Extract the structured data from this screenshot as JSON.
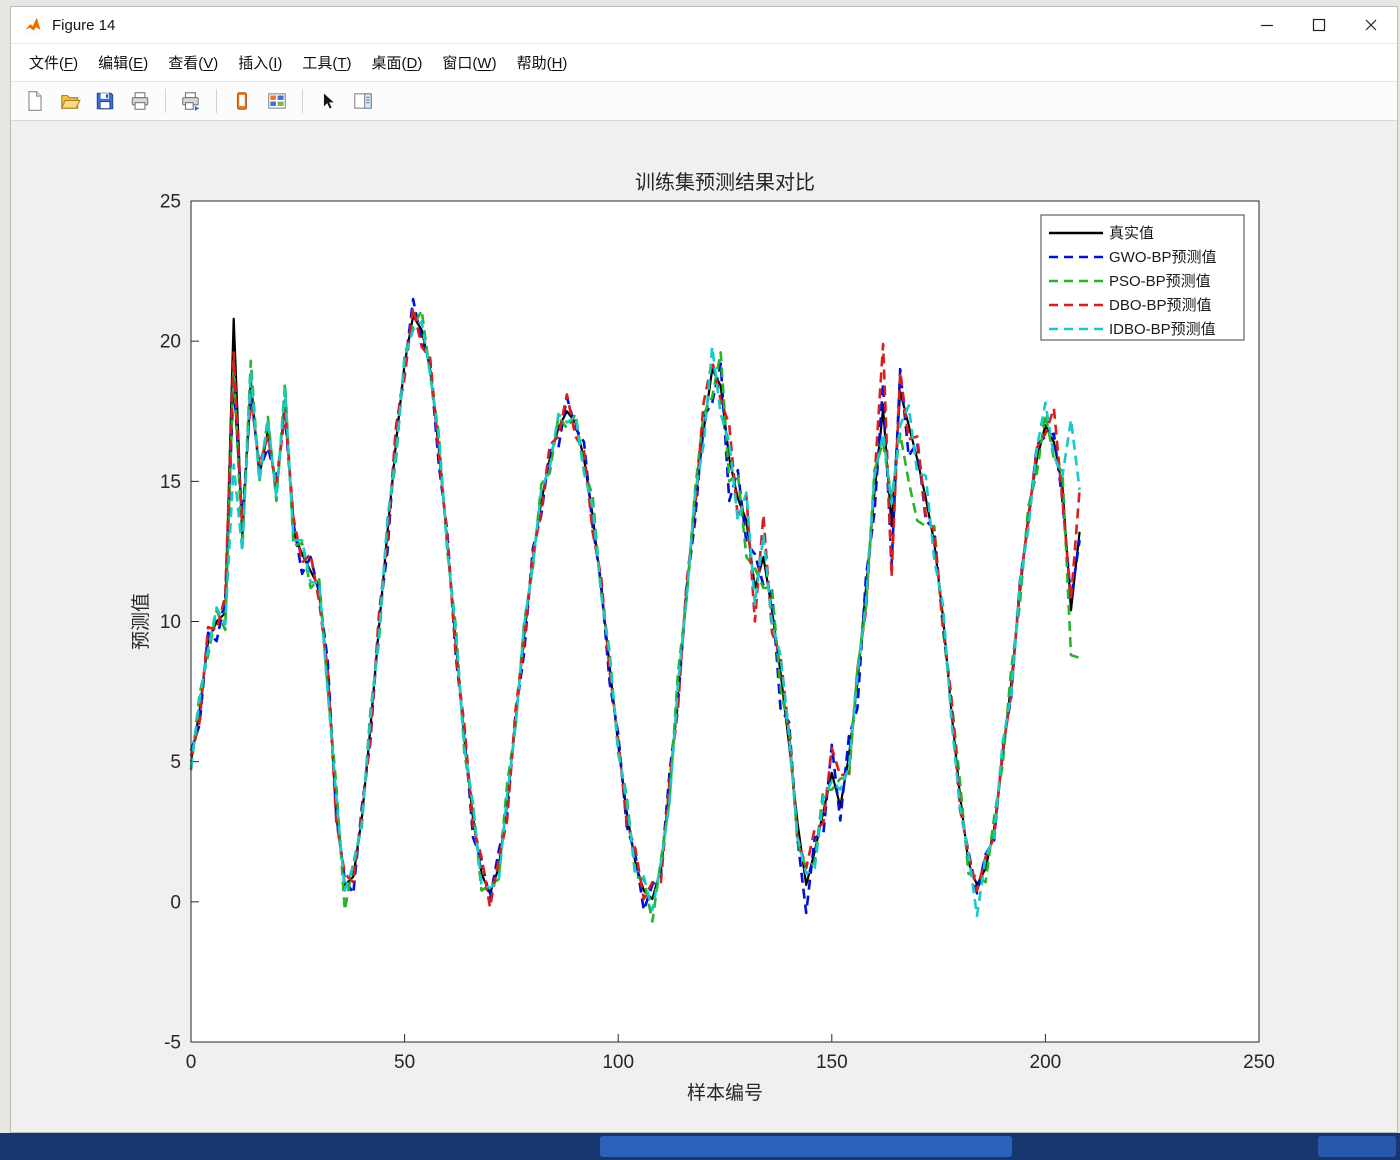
{
  "window": {
    "title": "Figure 14"
  },
  "menubar": {
    "items": [
      {
        "name": "file",
        "text": "文件",
        "key": "F"
      },
      {
        "name": "edit",
        "text": "编辑",
        "key": "E"
      },
      {
        "name": "view",
        "text": "查看",
        "key": "V"
      },
      {
        "name": "insert",
        "text": "插入",
        "key": "I"
      },
      {
        "name": "tools",
        "text": "工具",
        "key": "T"
      },
      {
        "name": "desktop",
        "text": "桌面",
        "key": "D"
      },
      {
        "name": "window",
        "text": "窗口",
        "key": "W"
      },
      {
        "name": "help",
        "text": "帮助",
        "key": "H"
      }
    ]
  },
  "toolbar": {
    "items": [
      {
        "icon": "new-figure-icon"
      },
      {
        "icon": "open-file-icon"
      },
      {
        "icon": "save-figure-icon"
      },
      {
        "icon": "print-figure-icon"
      },
      {
        "sep": true
      },
      {
        "icon": "print-preview-icon"
      },
      {
        "sep": true
      },
      {
        "icon": "mobile-preview-icon"
      },
      {
        "icon": "layout-grid-icon"
      },
      {
        "sep": true
      },
      {
        "icon": "edit-plot-cursor-icon"
      },
      {
        "icon": "side-panel-icon"
      }
    ]
  },
  "chart_data": {
    "type": "line",
    "title": "训练集预测结果对比",
    "xlabel": "样本编号",
    "ylabel": "预测值",
    "xlim": [
      0,
      250
    ],
    "ylim": [
      -5,
      25
    ],
    "x_ticks": [
      0,
      50,
      100,
      150,
      200,
      250
    ],
    "y_ticks": [
      -5,
      0,
      5,
      10,
      15,
      20,
      25
    ],
    "grid": false,
    "legend_position": "northeast",
    "x_start": 0,
    "x_step": 2,
    "base_values": [
      5.0,
      6.8,
      9.3,
      10.0,
      10.3,
      20.8,
      13.0,
      18.6,
      15.2,
      16.8,
      14.6,
      17.9,
      13.2,
      12.4,
      11.8,
      11.2,
      8.0,
      3.5,
      0.6,
      0.9,
      3.0,
      6.2,
      9.8,
      13.2,
      16.4,
      19.2,
      20.9,
      20.4,
      19.0,
      16.2,
      12.8,
      9.2,
      5.8,
      3.0,
      1.0,
      0.3,
      1.2,
      3.5,
      6.5,
      9.5,
      12.2,
      14.3,
      15.8,
      16.9,
      17.5,
      17.1,
      15.8,
      13.8,
      11.2,
      8.4,
      5.6,
      3.2,
      1.4,
      0.4,
      0.1,
      1.2,
      4.0,
      7.5,
      11.0,
      14.2,
      16.8,
      19.0,
      18.4,
      15.8,
      14.4,
      13.6,
      11.2,
      12.3,
      10.4,
      8.2,
      5.6,
      2.8,
      0.6,
      1.8,
      3.2,
      4.6,
      3.4,
      5.2,
      7.8,
      11.2,
      14.6,
      17.6,
      13.4,
      18.2,
      17.0,
      15.8,
      14.4,
      12.8,
      10.2,
      6.8,
      3.8,
      1.4,
      0.6,
      1.2,
      2.6,
      5.2,
      7.8,
      11.0,
      13.8,
      15.8,
      17.0,
      16.4,
      14.8,
      10.4,
      13.2
    ],
    "series": [
      {
        "name": "true",
        "label": "真实值",
        "color": "#000000",
        "style": "solid",
        "offsets": null
      },
      {
        "name": "gwo-bp",
        "label": "GWO-BP预测值",
        "color": "#0010d8",
        "style": "dashed",
        "offsets": [
          0.4,
          -0.5,
          0.3,
          -0.7,
          0.5,
          -2.2,
          0.6,
          -0.4,
          0.2,
          -0.6,
          0.4,
          -0.5,
          0.3,
          -0.7,
          0.5,
          -0.2,
          0.6,
          -0.4,
          0.2,
          -0.6,
          0.4,
          -0.5,
          0.3,
          -0.7,
          0.5,
          -0.2,
          0.6,
          -0.4,
          0.2,
          -0.6,
          0.4,
          -0.5,
          0.3,
          -0.7,
          0.5,
          -0.2,
          0.6,
          -0.4,
          0.2,
          -0.6,
          0.4,
          -0.5,
          0.3,
          -0.7,
          0.5,
          -0.2,
          0.6,
          -0.4,
          0.2,
          -0.6,
          0.4,
          -0.5,
          0.3,
          -0.7,
          0.5,
          -0.2,
          0.6,
          -0.4,
          0.2,
          -0.6,
          0.5,
          -1.2,
          0.8,
          -1.5,
          1.0,
          -0.8,
          1.2,
          -1.0,
          0.6,
          -1.3,
          0.8,
          -0.6,
          -1.0,
          0.5,
          -0.8,
          1.0,
          -0.5,
          0.7,
          -0.9,
          0.4,
          -0.7,
          0.9,
          -1.4,
          0.8,
          -1.1,
          0.6,
          -0.8,
          0.5,
          -0.4,
          0.3,
          -0.5,
          0.4,
          -0.3,
          0.5,
          -0.4,
          0.3,
          -0.5,
          0.4,
          -0.3,
          0.5,
          -0.4,
          0.3,
          -0.5,
          0.4,
          -0.3
        ]
      },
      {
        "name": "pso-bp",
        "label": "PSO-BP预测值",
        "color": "#28b428",
        "style": "dashed",
        "offsets": [
          -0.3,
          0.6,
          -0.5,
          0.4,
          -0.6,
          -1.6,
          -0.4,
          0.7,
          -0.2,
          0.5,
          -0.3,
          0.6,
          -0.5,
          0.4,
          -0.6,
          0.3,
          -0.4,
          0.7,
          -0.9,
          0.5,
          -0.3,
          0.6,
          -0.5,
          0.4,
          -0.6,
          0.3,
          -0.4,
          0.7,
          -0.2,
          0.5,
          -0.3,
          0.6,
          -0.5,
          0.4,
          -0.6,
          0.3,
          -0.4,
          0.7,
          -0.2,
          0.5,
          -0.3,
          0.6,
          -0.5,
          0.4,
          -0.6,
          0.3,
          -0.4,
          0.7,
          -0.2,
          0.5,
          -0.3,
          0.6,
          -0.5,
          0.4,
          -0.8,
          0.3,
          -0.4,
          0.7,
          -0.2,
          0.5,
          0.6,
          -1.0,
          1.2,
          -0.8,
          0.9,
          -1.3,
          0.7,
          -1.1,
          0.8,
          -0.6,
          0.5,
          -0.7,
          0.6,
          -0.4,
          0.8,
          -0.6,
          1.0,
          -0.8,
          0.5,
          -0.7,
          0.8,
          -1.2,
          1.0,
          -1.5,
          -2.0,
          -2.2,
          -1.0,
          0.6,
          -0.5,
          0.4,
          0.5,
          -0.4,
          0.3,
          -0.5,
          0.4,
          -0.3,
          0.5,
          -0.4,
          0.3,
          -0.5,
          0.4,
          -0.6,
          0.5,
          -1.6,
          -4.5
        ]
      },
      {
        "name": "dbo-bp",
        "label": "DBO-BP预测值",
        "color": "#d81e1e",
        "style": "dashed",
        "offsets": [
          0.2,
          -0.4,
          0.5,
          -0.3,
          0.6,
          -1.2,
          0.3,
          -0.6,
          0.4,
          -0.2,
          0.2,
          -0.4,
          0.5,
          -0.3,
          0.6,
          -0.5,
          0.3,
          -0.6,
          0.4,
          -0.2,
          0.2,
          -0.4,
          0.5,
          -0.3,
          0.6,
          -0.5,
          0.3,
          -0.6,
          0.4,
          -0.2,
          0.2,
          -0.4,
          0.5,
          -0.3,
          0.6,
          -0.5,
          0.3,
          -0.6,
          0.4,
          -0.2,
          0.2,
          -0.4,
          0.5,
          -0.3,
          0.6,
          -0.5,
          0.3,
          -0.6,
          0.4,
          -0.2,
          0.2,
          -0.4,
          0.5,
          -0.3,
          0.6,
          -0.5,
          0.3,
          -0.6,
          0.4,
          -0.2,
          1.0,
          0.3,
          -0.5,
          1.2,
          -0.7,
          0.9,
          -1.2,
          1.5,
          -0.8,
          0.6,
          0.4,
          -0.5,
          0.6,
          0.8,
          -0.4,
          0.9,
          1.1,
          -0.6,
          0.5,
          -0.8,
          0.5,
          2.3,
          -1.8,
          0.7,
          -0.5,
          0.8,
          -0.6,
          0.4,
          -0.3,
          0.5,
          -0.4,
          0.3,
          -0.2,
          0.4,
          -0.3,
          0.2,
          -0.4,
          0.3,
          -0.2,
          0.4,
          -0.3,
          1.2,
          -0.5,
          0.4,
          1.5
        ]
      },
      {
        "name": "idbo-bp",
        "label": "IDBO-BP预测值",
        "color": "#17c9c9",
        "style": "dashed",
        "offsets": [
          -0.2,
          0.4,
          -0.3,
          0.5,
          -0.4,
          -5.2,
          -0.5,
          0.3,
          -0.2,
          0.4,
          -0.2,
          0.4,
          -0.3,
          0.5,
          -0.4,
          0.2,
          -0.5,
          0.3,
          -0.2,
          0.4,
          -0.2,
          0.4,
          -0.3,
          0.5,
          -0.4,
          0.2,
          -0.5,
          0.3,
          -0.2,
          0.4,
          -0.2,
          0.4,
          -0.3,
          0.5,
          -0.4,
          0.2,
          -0.5,
          0.3,
          -0.2,
          0.4,
          -0.2,
          0.4,
          -0.3,
          0.5,
          -0.4,
          0.2,
          -0.5,
          0.3,
          -0.2,
          0.4,
          -0.2,
          0.4,
          -0.3,
          0.5,
          -0.4,
          0.2,
          -0.5,
          0.3,
          -0.2,
          0.4,
          -0.5,
          0.8,
          -1.0,
          0.6,
          -0.8,
          1.0,
          -0.6,
          0.8,
          -0.5,
          0.6,
          0.3,
          -0.5,
          0.4,
          -0.6,
          0.5,
          -0.3,
          0.6,
          -0.4,
          0.3,
          -0.5,
          0.6,
          -0.9,
          0.8,
          -1.2,
          0.7,
          -0.5,
          0.8,
          -0.6,
          0.4,
          -0.3,
          -0.4,
          0.3,
          -1.1,
          0.4,
          -0.3,
          0.5,
          -0.4,
          0.3,
          -0.5,
          0.4,
          0.8,
          -0.5,
          0.4,
          6.8,
          1.5
        ]
      }
    ]
  }
}
